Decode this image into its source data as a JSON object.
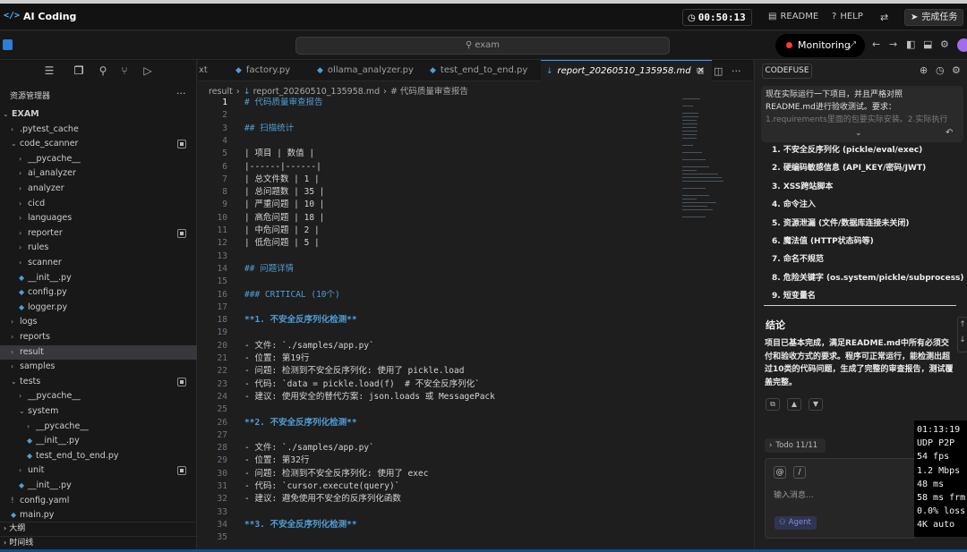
{
  "header": {
    "app_title": "AI Coding",
    "timer": "00:50:13",
    "readme_label": "README",
    "help_label": "HELP",
    "finish_label": "完成任务"
  },
  "toolbar": {
    "search_placeholder": "exam",
    "monitoring_label": "Monitoring"
  },
  "explorer": {
    "title": "资源管理器",
    "more": "···",
    "tree": [
      {
        "label": "EXAM",
        "depth": 0,
        "kind": "folder-open",
        "bold": true
      },
      {
        "label": ".pytest_cache",
        "depth": 1,
        "kind": "folder"
      },
      {
        "label": "code_scanner",
        "depth": 1,
        "kind": "folder-open",
        "badge": true
      },
      {
        "label": "__pycache__",
        "depth": 2,
        "kind": "folder"
      },
      {
        "label": "ai_analyzer",
        "depth": 2,
        "kind": "folder"
      },
      {
        "label": "analyzer",
        "depth": 2,
        "kind": "folder"
      },
      {
        "label": "cicd",
        "depth": 2,
        "kind": "folder"
      },
      {
        "label": "languages",
        "depth": 2,
        "kind": "folder"
      },
      {
        "label": "reporter",
        "depth": 2,
        "kind": "folder",
        "badge": true
      },
      {
        "label": "rules",
        "depth": 2,
        "kind": "folder"
      },
      {
        "label": "scanner",
        "depth": 2,
        "kind": "folder"
      },
      {
        "label": "__init__.py",
        "depth": 2,
        "kind": "py"
      },
      {
        "label": "config.py",
        "depth": 2,
        "kind": "py"
      },
      {
        "label": "logger.py",
        "depth": 2,
        "kind": "py"
      },
      {
        "label": "logs",
        "depth": 1,
        "kind": "folder"
      },
      {
        "label": "reports",
        "depth": 1,
        "kind": "folder"
      },
      {
        "label": "result",
        "depth": 1,
        "kind": "folder",
        "selected": true
      },
      {
        "label": "samples",
        "depth": 1,
        "kind": "folder"
      },
      {
        "label": "tests",
        "depth": 1,
        "kind": "folder-open",
        "badge": true
      },
      {
        "label": "__pycache__",
        "depth": 2,
        "kind": "folder"
      },
      {
        "label": "system",
        "depth": 2,
        "kind": "folder-open"
      },
      {
        "label": "__pycache__",
        "depth": 3,
        "kind": "folder"
      },
      {
        "label": "__init__.py",
        "depth": 3,
        "kind": "py"
      },
      {
        "label": "test_end_to_end.py",
        "depth": 3,
        "kind": "py"
      },
      {
        "label": "unit",
        "depth": 2,
        "kind": "folder",
        "badge": true
      },
      {
        "label": "__init__.py",
        "depth": 2,
        "kind": "py"
      },
      {
        "label": "config.yaml",
        "depth": 1,
        "kind": "yml"
      },
      {
        "label": "main.py",
        "depth": 1,
        "kind": "py"
      }
    ],
    "outline_label": "大纲",
    "timeline_label": "时间线"
  },
  "tabs": [
    {
      "label": "xt"
    },
    {
      "label": "factory.py"
    },
    {
      "label": "ollama_analyzer.py"
    },
    {
      "label": "test_end_to_end.py"
    },
    {
      "label": "report_20260510_135958.md",
      "active": true
    }
  ],
  "breadcrumb": {
    "folder": "result",
    "file": "report_20260510_135958.md",
    "section": "# 代码质量审查报告"
  },
  "editor": {
    "current_line": 1,
    "lines": [
      {
        "n": "1",
        "t": "# 代码质量审查报告",
        "s": "h"
      },
      {
        "n": "2",
        "t": "",
        "s": ""
      },
      {
        "n": "3",
        "t": "## 扫描统计",
        "s": "h"
      },
      {
        "n": "4",
        "t": "",
        "s": ""
      },
      {
        "n": "5",
        "t": "| 项目 | 数值 |",
        "s": ""
      },
      {
        "n": "6",
        "t": "|------|------|",
        "s": ""
      },
      {
        "n": "7",
        "t": "| 总文件数 | 1 |",
        "s": ""
      },
      {
        "n": "8",
        "t": "| 总问题数 | 35 |",
        "s": ""
      },
      {
        "n": "9",
        "t": "| 严重问题 | 10 |",
        "s": ""
      },
      {
        "n": "10",
        "t": "| 高危问题 | 18 |",
        "s": ""
      },
      {
        "n": "11",
        "t": "| 中危问题 | 2 |",
        "s": ""
      },
      {
        "n": "12",
        "t": "| 低危问题 | 5 |",
        "s": ""
      },
      {
        "n": "13",
        "t": "",
        "s": ""
      },
      {
        "n": "14",
        "t": "## 问题详情",
        "s": "h"
      },
      {
        "n": "15",
        "t": "",
        "s": ""
      },
      {
        "n": "16",
        "t": "### CRITICAL (10个)",
        "s": "h"
      },
      {
        "n": "17",
        "t": "",
        "s": ""
      },
      {
        "n": "18",
        "t": "**1. 不安全反序列化检测**",
        "s": "b"
      },
      {
        "n": "19",
        "t": "",
        "s": ""
      },
      {
        "n": "20",
        "t": "- 文件: `./samples/app.py`",
        "s": "li"
      },
      {
        "n": "21",
        "t": "- 位置: 第19行",
        "s": "li"
      },
      {
        "n": "22",
        "t": "- 问题: 检测到不安全反序列化: 使用了 pickle.load",
        "s": "li"
      },
      {
        "n": "23",
        "t": "- 代码: `data = pickle.load(f)  # 不安全反序列化`",
        "s": "li"
      },
      {
        "n": "24",
        "t": "- 建议: 使用安全的替代方案: json.loads 或 MessagePack",
        "s": "li"
      },
      {
        "n": "25",
        "t": "",
        "s": ""
      },
      {
        "n": "26",
        "t": "**2. 不安全反序列化检测**",
        "s": "b"
      },
      {
        "n": "27",
        "t": "",
        "s": ""
      },
      {
        "n": "28",
        "t": "- 文件: `./samples/app.py`",
        "s": "li"
      },
      {
        "n": "29",
        "t": "- 位置: 第32行",
        "s": "li"
      },
      {
        "n": "30",
        "t": "- 问题: 检测到不安全反序列化: 使用了 exec",
        "s": "li"
      },
      {
        "n": "31",
        "t": "- 代码: `cursor.execute(query)`",
        "s": "li"
      },
      {
        "n": "32",
        "t": "- 建议: 避免使用不安全的反序列化函数",
        "s": "li"
      },
      {
        "n": "33",
        "t": "",
        "s": ""
      },
      {
        "n": "34",
        "t": "**3. 不安全反序列化检测**",
        "s": "b"
      },
      {
        "n": "35",
        "t": "",
        "s": ""
      }
    ]
  },
  "assistant": {
    "tab_label": "CODEFUSE",
    "prompt_line1": "现在实际运行一下项目，并且严格对照",
    "prompt_line2": "README.md进行验收测试。要求：",
    "prompt_line3": "1.requirements里面的包要实际安装。2.实际执行",
    "list": [
      "1. 不安全反序列化 (pickle/eval/exec)",
      "2. 硬编码敏感信息 (API_KEY/密码/JWT)",
      "3. XSS跨站脚本",
      "4. 命令注入",
      "5. 资源泄漏 (文件/数据库连接未关闭)",
      "6. 魔法值 (HTTP状态码等)",
      "7. 命名不规范",
      "8. 危险关键字 (os.system/pickle/subprocess)",
      "9. 短变量名"
    ],
    "conclusion_title": "结论",
    "conclusion_text": "项目已基本完成，满足README.md中所有必须交付和验收方式的要求。程序可正常运行，能检测出超过10类的代码问题，生成了完整的审查报告，测试覆盖完整。",
    "todo_label": "Todo 11/11",
    "input_placeholder": "输入消息...",
    "at_label": "@",
    "slash_label": "/",
    "agent_label": "Agent"
  },
  "stats_overlay": [
    "01:13:19",
    "UDP P2P",
    "54 fps",
    "1.2 Mbps",
    "48 ms",
    "58 ms frm",
    "0.0% loss",
    "4K auto"
  ]
}
